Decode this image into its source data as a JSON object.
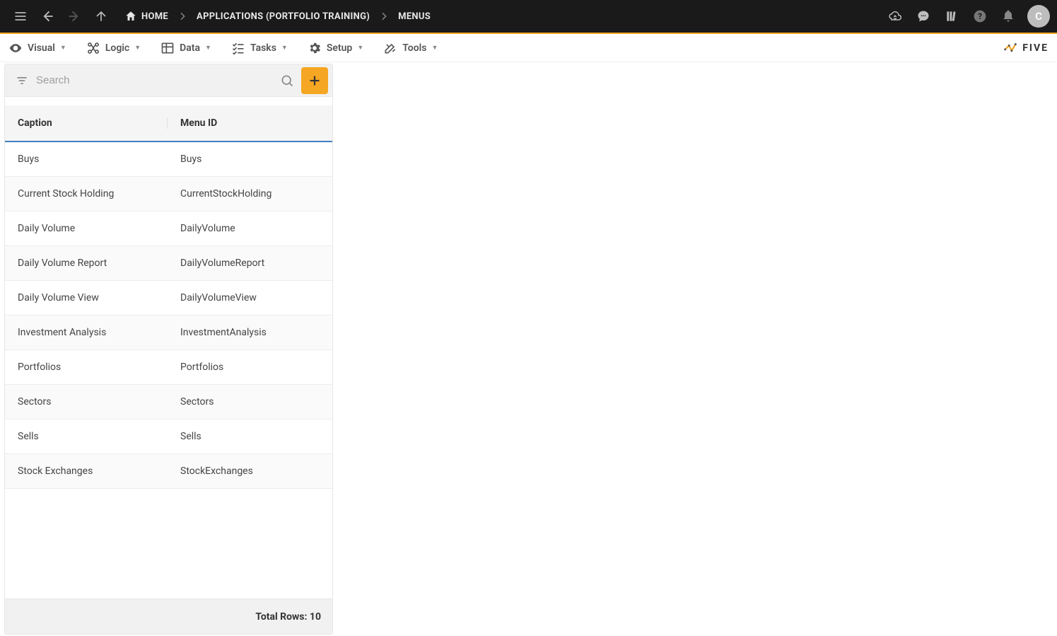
{
  "topbar": {
    "breadcrumbs": [
      {
        "label": "HOME"
      },
      {
        "label": "APPLICATIONS (PORTFOLIO TRAINING)"
      },
      {
        "label": "MENUS"
      }
    ],
    "avatar_letter": "C"
  },
  "menubar": {
    "items": [
      {
        "label": "Visual"
      },
      {
        "label": "Logic"
      },
      {
        "label": "Data"
      },
      {
        "label": "Tasks"
      },
      {
        "label": "Setup"
      },
      {
        "label": "Tools"
      }
    ],
    "brand": "FIVE"
  },
  "panel": {
    "search_placeholder": "Search",
    "columns": {
      "caption": "Caption",
      "menu_id": "Menu ID"
    },
    "rows": [
      {
        "caption": "Buys",
        "menu_id": "Buys"
      },
      {
        "caption": "Current Stock Holding",
        "menu_id": "CurrentStockHolding"
      },
      {
        "caption": "Daily Volume",
        "menu_id": "DailyVolume"
      },
      {
        "caption": "Daily Volume Report",
        "menu_id": "DailyVolumeReport"
      },
      {
        "caption": "Daily Volume View",
        "menu_id": "DailyVolumeView"
      },
      {
        "caption": "Investment Analysis",
        "menu_id": "InvestmentAnalysis"
      },
      {
        "caption": "Portfolios",
        "menu_id": "Portfolios"
      },
      {
        "caption": "Sectors",
        "menu_id": "Sectors"
      },
      {
        "caption": "Sells",
        "menu_id": "Sells"
      },
      {
        "caption": "Stock Exchanges",
        "menu_id": "StockExchanges"
      }
    ],
    "footer": "Total Rows: 10"
  }
}
